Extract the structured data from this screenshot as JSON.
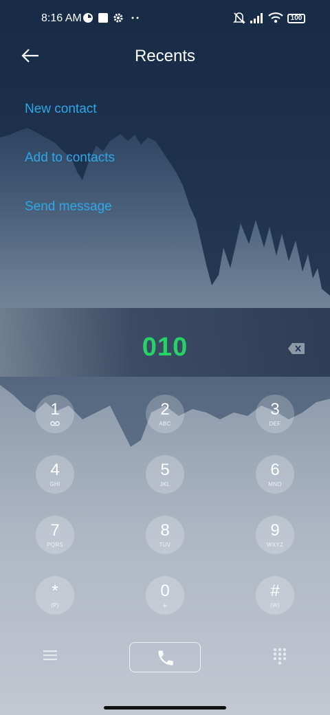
{
  "status_bar": {
    "time": "8:16 AM",
    "battery": "100",
    "icons": [
      "vpn-icon",
      "notification-square-icon",
      "gear-icon",
      "more-dots-icon",
      "mute-icon",
      "signal-icon",
      "wifi-icon",
      "battery-icon"
    ]
  },
  "header": {
    "title": "Recents",
    "back_icon": "arrow-left-icon"
  },
  "actions": [
    {
      "label": "New contact"
    },
    {
      "label": "Add to contacts"
    },
    {
      "label": "Send message"
    }
  ],
  "dialed_number": "010",
  "keypad": [
    {
      "digit": "1",
      "sub": ""
    },
    {
      "digit": "2",
      "sub": "ABC"
    },
    {
      "digit": "3",
      "sub": "DEF"
    },
    {
      "digit": "4",
      "sub": "GHI"
    },
    {
      "digit": "5",
      "sub": "JKL"
    },
    {
      "digit": "6",
      "sub": "MNO"
    },
    {
      "digit": "7",
      "sub": "PQRS"
    },
    {
      "digit": "8",
      "sub": "TUV"
    },
    {
      "digit": "9",
      "sub": "WXYZ"
    },
    {
      "digit": "*",
      "sub": "(P)"
    },
    {
      "digit": "0",
      "sub": "+"
    },
    {
      "digit": "#",
      "sub": "(W)"
    }
  ],
  "bottom_bar": {
    "icons": [
      "menu-icon",
      "phone-icon",
      "dialpad-icon"
    ]
  },
  "colors": {
    "accent_link": "#2ea6e8",
    "dialed_number": "#25d366"
  }
}
